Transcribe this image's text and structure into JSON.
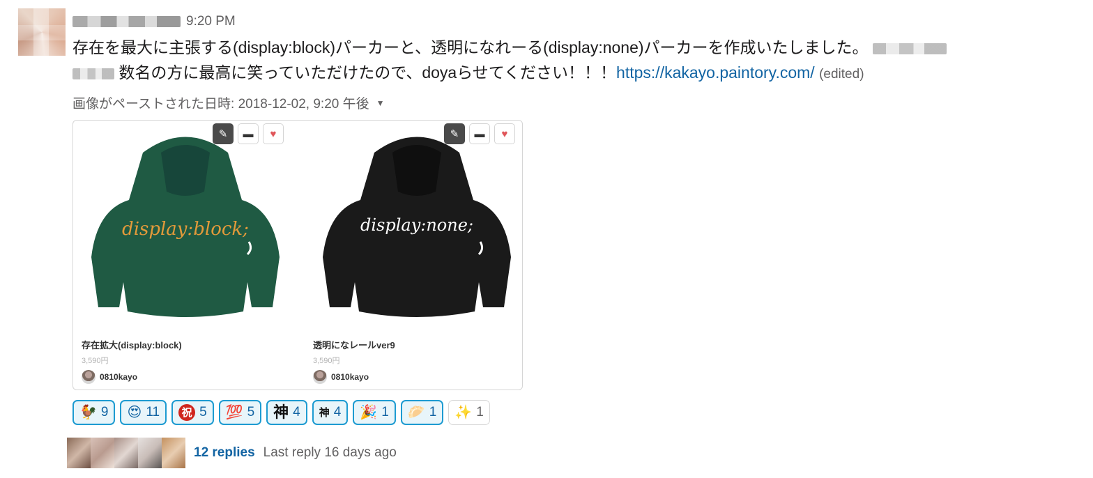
{
  "message": {
    "time": "9:20 PM",
    "text_line1": "存在を最大に主張する(display:block)パーカーと、透明になれーる(display:none)パーカーを作成いたしました。",
    "text_line2": "数名の方に最高に笑っていただけたので、doyaらせてください！！！",
    "link": "https://kakayo.paintory.com/",
    "edited": "(edited)",
    "paste_meta": "画像がペーストされた日時: 2018-12-02, 9:20 午後"
  },
  "attachment": {
    "products": [
      {
        "title": "存在拡大(display:block)",
        "price": "3,590円",
        "seller": "0810kayo",
        "print_text": "display:block;",
        "hoodie_color": "#1f5a43",
        "print_color": "#e39a3a"
      },
      {
        "title": "透明になレールver9",
        "price": "3,590円",
        "seller": "0810kayo",
        "print_text": "display:none;",
        "hoodie_color": "#1a1a1a",
        "print_color": "#ffffff"
      }
    ],
    "icons": [
      "pencil-icon",
      "folder-icon",
      "heart-icon"
    ]
  },
  "reactions": [
    {
      "emoji": "🐓",
      "count": "9"
    },
    {
      "emoji": "😍",
      "count": "11"
    },
    {
      "emoji": "祝",
      "count": "5"
    },
    {
      "emoji": "💯",
      "count": "5"
    },
    {
      "emoji": "神",
      "count": "4"
    },
    {
      "emoji": "神",
      "count": "4"
    },
    {
      "emoji": "🎉",
      "count": "1"
    },
    {
      "emoji": "🥟",
      "count": "1"
    },
    {
      "emoji": "✨",
      "count": "1"
    }
  ],
  "thread": {
    "replies": "12 replies",
    "last_reply": "Last reply 16 days ago"
  },
  "colors": {
    "link": "#1264a3",
    "reaction_border": "#1d9bd1",
    "reaction_bg": "#e8f5fa"
  }
}
